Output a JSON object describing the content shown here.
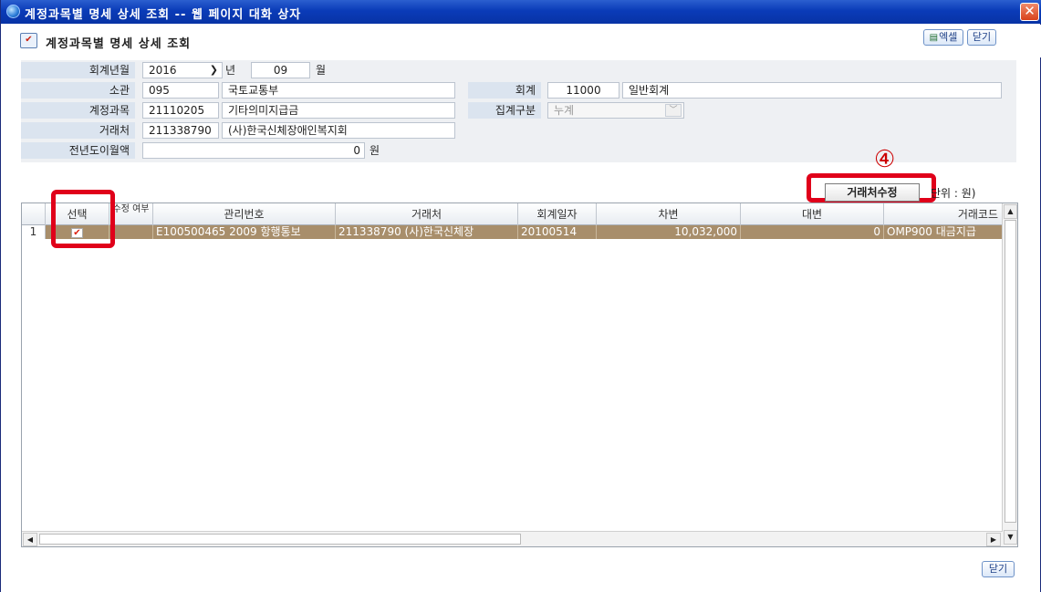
{
  "window": {
    "title": "계정과목별 명세 상세 조회 -- 웹 페이지 대화 상자",
    "close_glyph": "✕"
  },
  "header": {
    "title": "계정과목별 명세 상세 조회",
    "excel_label": "엑셀",
    "close_label": "닫기"
  },
  "form": {
    "year_month_label": "회계년월",
    "year_value": "2016",
    "year_unit": "년",
    "month_value": "09",
    "month_unit": "월",
    "office_label": "소관",
    "office_code": "095",
    "office_name": "국토교통부",
    "account_label": "회계",
    "account_code": "11000",
    "account_name": "일반회계",
    "subject_label": "계정과목",
    "subject_code": "21110205",
    "subject_name": "기타의미지급금",
    "aggregate_label": "집계구분",
    "aggregate_value": "누계",
    "vendor_label": "거래처",
    "vendor_code": "211338790",
    "vendor_name": "(사)한국신체장애인복지회",
    "prev_balance_label": "전년도이월액",
    "prev_balance_value": "0",
    "prev_balance_unit": "원"
  },
  "toolbar": {
    "annotation": "④",
    "edit_vendor_label": "거래처수정",
    "unit_label": "단위 : 원)"
  },
  "grid": {
    "columns": [
      "선택",
      "수정 여부",
      "관리번호",
      "거래처",
      "회계일자",
      "차변",
      "대변",
      "거래코드"
    ],
    "rows": [
      {
        "rownum": "1",
        "selected": "✔",
        "modified": "",
        "mgmt_no": "E100500465 2009 항행통보",
        "vendor": "211338790 (사)한국신체장",
        "date": "20100514",
        "debit": "10,032,000",
        "credit": "0",
        "code": "OMP900 대금지급"
      }
    ]
  },
  "footer": {
    "close_label": "닫기"
  },
  "colors": {
    "titlebar": "#0a3bb8",
    "selected_row": "#a88e6b",
    "highlight": "#e0001a"
  }
}
